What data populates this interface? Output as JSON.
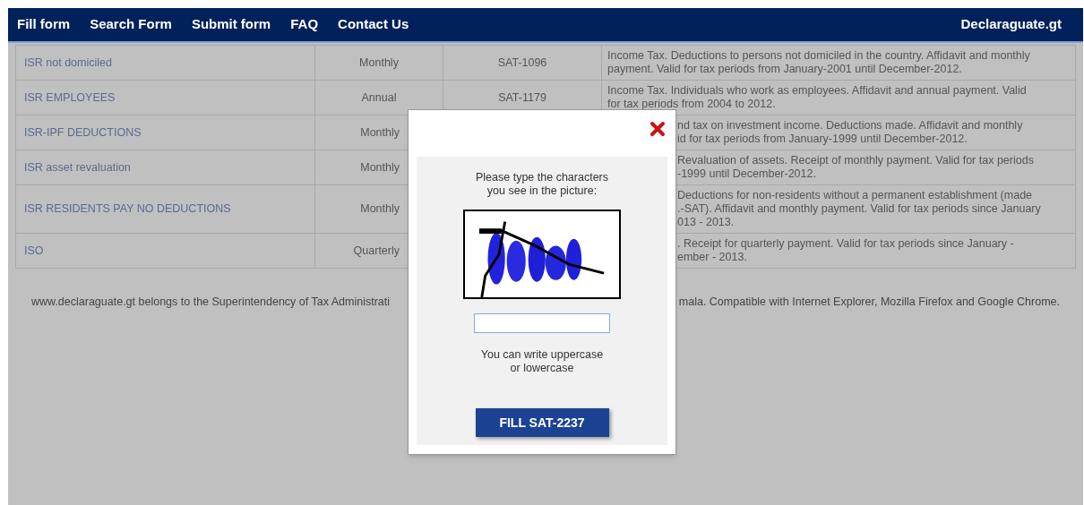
{
  "nav": {
    "links": [
      "Fill form",
      "Search Form",
      "Submit form",
      "FAQ",
      "Contact Us"
    ],
    "brand": "Declaraguate.gt"
  },
  "table": {
    "rows": [
      {
        "name": "ISR not domiciled",
        "period": "Monthly",
        "form": "SAT-1096",
        "description": [
          "Income Tax. Deductions to persons not domiciled in the country. Affidavit and monthly",
          "payment. Valid for tax periods from January-2001 until December-2012."
        ]
      },
      {
        "name": "ISR EMPLOYEES",
        "period": "Annual",
        "form": "SAT-1179",
        "description": [
          "Income Tax. Individuals who work as employees. Affidavit and annual payment. Valid",
          "for tax periods from 2004 to 2012."
        ]
      },
      {
        "name": "ISR-IPF DEDUCTIONS",
        "period": "Monthly",
        "description": [
          "nd tax on investment income. Deductions made. Affidavit and monthly",
          "id for tax periods from January-1999 until December-2012."
        ]
      },
      {
        "name": "ISR asset revaluation",
        "period": "Monthly",
        "description": [
          "Revaluation of assets. Receipt of monthly payment. Valid for tax periods",
          "-1999 until December-2012."
        ]
      },
      {
        "name": "ISR RESIDENTS PAY NO DEDUCTIONS",
        "period": "Monthly",
        "description": [
          "Deductions for non-residents without a permanent establishment (made",
          ".-SAT). Affidavit and monthly payment. Valid for tax periods since January",
          "013 - 2013."
        ]
      },
      {
        "name": "ISO",
        "period": "Quarterly",
        "description": [
          ". Receipt for quarterly payment. Valid for tax periods since January -",
          "ember - 2013."
        ]
      }
    ]
  },
  "footer": [
    "www.declaraguate.gt belongs to the Superintendency of Tax Administrati",
    "mala. Compatible with Internet Explorer, Mozilla Firefox and Google Chrome."
  ],
  "dialog": {
    "prompt": [
      "Please type the characters",
      "you see in the picture:"
    ],
    "hint": [
      "You can write uppercase",
      "or lowercase"
    ],
    "button": "FILL SAT-2237"
  }
}
